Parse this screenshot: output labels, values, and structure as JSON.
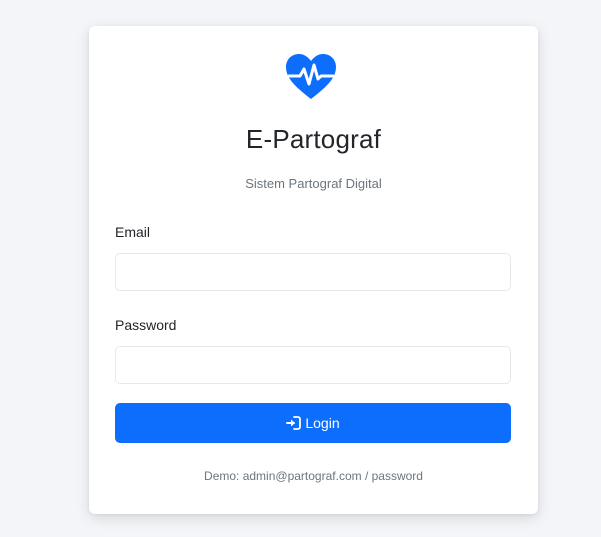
{
  "app": {
    "title": "E-Partograf",
    "subtitle": "Sistem Partograf Digital"
  },
  "form": {
    "email_label": "Email",
    "email_value": "",
    "email_placeholder": "",
    "password_label": "Password",
    "password_value": "",
    "password_placeholder": "",
    "login_label": "Login",
    "login_icon": "sign-in-icon"
  },
  "demo": {
    "text": "Demo: admin@partograf.com / password"
  },
  "colors": {
    "accent": "#0d6efd",
    "background": "#f3f5f8",
    "card": "#ffffff"
  },
  "icons": {
    "logo": "heart-pulse-icon"
  }
}
